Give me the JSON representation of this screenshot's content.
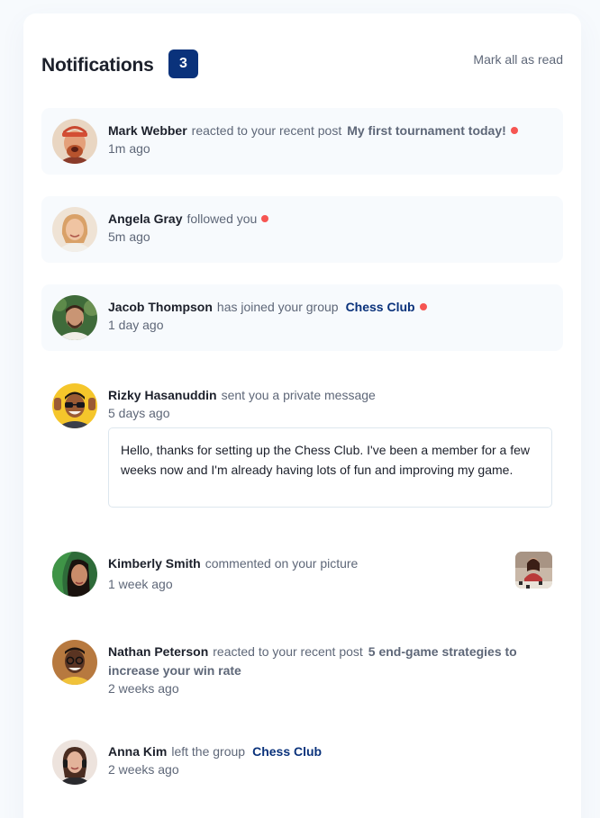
{
  "header": {
    "title": "Notifications",
    "unread_count": "3",
    "mark_all_label": "Mark all as read"
  },
  "notifications": [
    {
      "name": "Mark Webber",
      "action": "reacted to your recent post",
      "target": "My first tournament today!",
      "time": "1m ago",
      "unread": true
    },
    {
      "name": "Angela Gray",
      "action": "followed you",
      "time": "5m ago",
      "unread": true
    },
    {
      "name": "Jacob Thompson",
      "action": "has joined your group",
      "target": "Chess Club",
      "time": "1 day ago",
      "unread": true
    },
    {
      "name": "Rizky Hasanuddin",
      "action": "sent you a private message",
      "time": "5 days ago",
      "message": "Hello, thanks for setting up the Chess Club. I've been a member for a few weeks now and I'm already having lots of fun and improving my game.",
      "unread": false
    },
    {
      "name": "Kimberly Smith",
      "action": "commented on your picture",
      "time": "1 week ago",
      "unread": false
    },
    {
      "name": "Nathan Peterson",
      "action": "reacted to your recent post",
      "target": "5 end-game strategies to increase your win rate",
      "time": "2 weeks ago",
      "unread": false
    },
    {
      "name": "Anna Kim",
      "action": "left the group",
      "target": "Chess Club",
      "time": "2 weeks ago",
      "unread": false
    }
  ],
  "colors": {
    "accent": "#0a327b",
    "unread_dot": "#f65552",
    "unread_bg": "#f7fafd",
    "heading": "#1c202b",
    "body_text": "#5e6778"
  }
}
